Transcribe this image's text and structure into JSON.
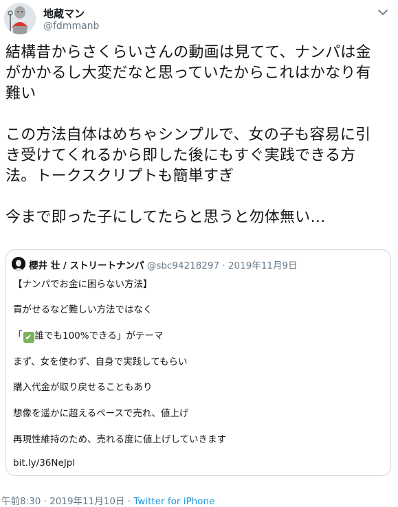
{
  "author": {
    "display_name": "地蔵マン",
    "handle": "@fdmmanb"
  },
  "tweet": {
    "text": "結構昔からさくらいさんの動画は見てて、ナンパは金\nがかかるし大変だなと思っていたからこれはかなり有\n難い\n\nこの方法自体はめちゃシンプルで、女の子も容易に引\nき受けてくれるから即した後にもすぐ実践できる方\n法。トークスクリプトも簡単すぎ\n\n今まで即った子にしてたらと思うと勿体無い…"
  },
  "quoted": {
    "name": "櫻井 壮 / ストリートナンパ",
    "handle": "@sbc94218297",
    "separator": " · ",
    "date": "2019年11月9日",
    "lines": {
      "l1": "【ナンパでお金に困らない方法】",
      "l2": "貢がせるなど難しい方法ではなく",
      "l3a": "「",
      "l3b": "誰でも100%できる」がテーマ",
      "l4": "まず、女を使わず、自身で実践してもらい",
      "l5": "購入代金が取り戻せることもあり",
      "l6": "想像を遥かに超えるペースで売れ、値上げ",
      "l7": "再現性維持のため、売れる度に値上げしていきます",
      "l8": "bit.ly/36NeJpl"
    }
  },
  "meta": {
    "time": "午前8:30",
    "separator": " · ",
    "date": "2019年11月10日",
    "source": "Twitter for iPhone"
  },
  "icons": {
    "caret": "chevron-down-icon",
    "check": "check-mark-button-icon"
  }
}
